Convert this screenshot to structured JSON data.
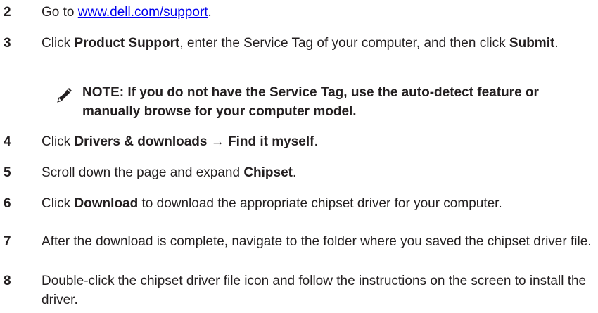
{
  "steps": [
    {
      "num": "2",
      "parts": [
        {
          "text": "Go to ",
          "style": "plain"
        },
        {
          "text": "www.dell.com/support",
          "style": "link"
        },
        {
          "text": ".",
          "style": "plain"
        }
      ]
    },
    {
      "num": "3",
      "parts": [
        {
          "text": "Click ",
          "style": "plain"
        },
        {
          "text": "Product Support",
          "style": "bold"
        },
        {
          "text": ", enter the Service Tag of your computer, and then click ",
          "style": "plain"
        },
        {
          "text": "Submit",
          "style": "bold"
        },
        {
          "text": ".",
          "style": "plain"
        }
      ]
    },
    {
      "num": "4",
      "parts": [
        {
          "text": "Click ",
          "style": "plain"
        },
        {
          "text": "Drivers & downloads",
          "style": "bold"
        },
        {
          "text": " → ",
          "style": "plain"
        },
        {
          "text": "Find it myself",
          "style": "bold"
        },
        {
          "text": ".",
          "style": "plain"
        }
      ]
    },
    {
      "num": "5",
      "parts": [
        {
          "text": "Scroll down the page and expand ",
          "style": "plain"
        },
        {
          "text": "Chipset",
          "style": "bold"
        },
        {
          "text": ".",
          "style": "plain"
        }
      ]
    },
    {
      "num": "6",
      "parts": [
        {
          "text": "Click ",
          "style": "plain"
        },
        {
          "text": "Download",
          "style": "bold"
        },
        {
          "text": " to download the appropriate chipset driver for your computer.",
          "style": "plain"
        }
      ]
    },
    {
      "num": "7",
      "parts": [
        {
          "text": "After the download is complete, navigate to the folder where you saved the chipset driver file.",
          "style": "plain"
        }
      ]
    },
    {
      "num": "8",
      "parts": [
        {
          "text": "Double-click the chipset driver file icon and follow the instructions on the screen to install the driver.",
          "style": "plain"
        }
      ]
    }
  ],
  "note": {
    "icon": "note-pencil-icon",
    "text": "NOTE: If you do not have the Service Tag, use the auto-detect feature or manually browse for your computer model."
  }
}
